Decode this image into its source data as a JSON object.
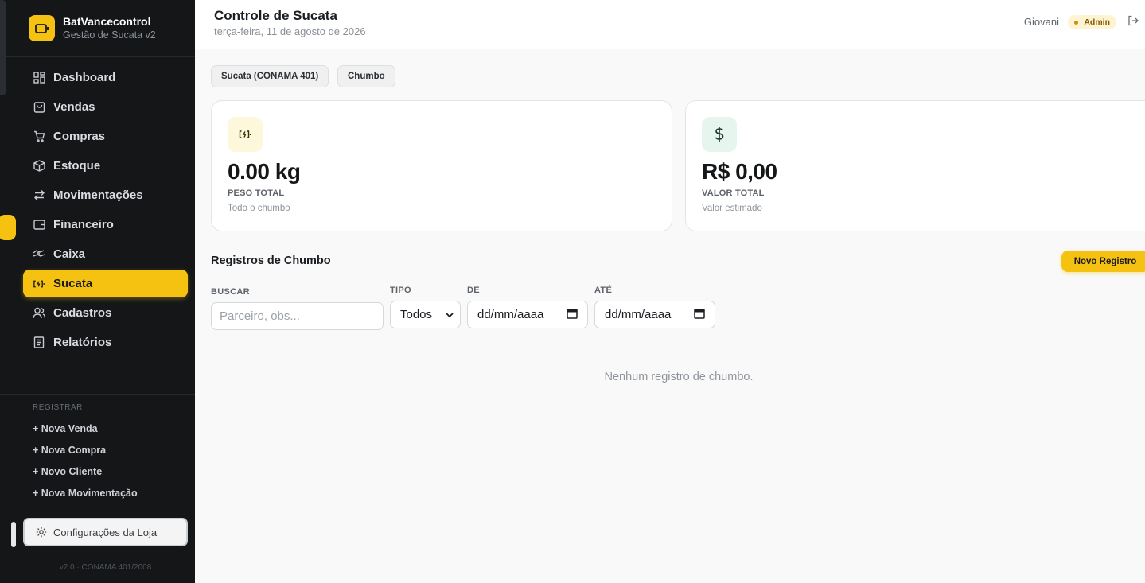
{
  "brand": {
    "name": "BatVancecontrol",
    "subtitle": "Gestão de Sucata v2"
  },
  "sidebar": {
    "items": [
      {
        "label": "Dashboard",
        "icon": "dashboard-icon"
      },
      {
        "label": "Vendas",
        "icon": "shopping-bag-icon"
      },
      {
        "label": "Compras",
        "icon": "cart-icon"
      },
      {
        "label": "Estoque",
        "icon": "box-icon"
      },
      {
        "label": "Movimentações",
        "icon": "arrows-icon"
      },
      {
        "label": "Financeiro",
        "icon": "wallet-icon"
      },
      {
        "label": "Caixa",
        "icon": "cash-icon"
      },
      {
        "label": "Sucata",
        "icon": "battery-icon",
        "active": true
      },
      {
        "label": "Cadastros",
        "icon": "users-icon"
      },
      {
        "label": "Relatórios",
        "icon": "report-icon"
      }
    ],
    "register_title": "REGISTRAR",
    "register_links": [
      "+ Nova Venda",
      "+ Nova Compra",
      "+ Novo Cliente",
      "+ Nova Movimentação"
    ],
    "config_label": "Configurações da Loja",
    "version": "v2.0 · CONAMA 401/2008"
  },
  "header": {
    "title": "Controle de Sucata",
    "date": "terça-feira, 11 de agosto de 2026",
    "user": "Giovani",
    "role": "Admin"
  },
  "tabs": [
    "Sucata (CONAMA 401)",
    "Chumbo"
  ],
  "cards": [
    {
      "value": "0.00 kg",
      "label": "PESO TOTAL",
      "sub": "Todo o chumbo",
      "icon": "battery-icon"
    },
    {
      "value": "R$ 0,00",
      "label": "VALOR TOTAL",
      "sub": "Valor estimado",
      "icon": "dollar-icon"
    }
  ],
  "section": {
    "title": "Registros de Chumbo",
    "new_button": "Novo Registro"
  },
  "filters": {
    "search_label": "BUSCAR",
    "search_placeholder": "Parceiro, obs...",
    "type_label": "TIPO",
    "type_value": "Todos",
    "from_label": "DE",
    "from_value": "dd/mm/aaaa",
    "to_label": "ATÉ",
    "to_value": "dd/mm/aaaa"
  },
  "empty_message": "Nenhum registro de chumbo.",
  "colors": {
    "accent": "#f5c211",
    "sidebar_bg": "#141618",
    "page_bg": "#f9f9f9"
  }
}
